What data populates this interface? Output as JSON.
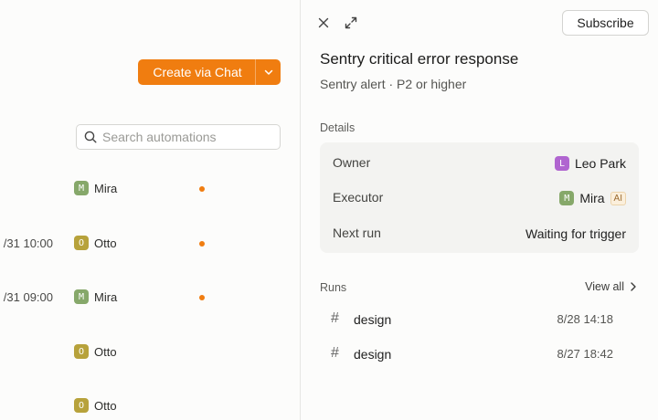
{
  "left": {
    "create_button": "Create via Chat",
    "search_placeholder": "Search automations",
    "rows": [
      {
        "time": "",
        "user_initial": "M",
        "user": "Mira",
        "dot": true
      },
      {
        "time": "/31 10:00",
        "user_initial": "O",
        "user": "Otto",
        "dot": true
      },
      {
        "time": "/31 09:00",
        "user_initial": "M",
        "user": "Mira",
        "dot": true
      },
      {
        "time": "",
        "user_initial": "O",
        "user": "Otto",
        "dot": false
      },
      {
        "time": "",
        "user_initial": "O",
        "user": "Otto",
        "dot": false
      }
    ]
  },
  "panel": {
    "subscribe": "Subscribe",
    "title": "Sentry critical error response",
    "subtitle": "Sentry alert · P2 or higher",
    "details_label": "Details",
    "details": {
      "owner_label": "Owner",
      "owner_initial": "L",
      "owner": "Leo Park",
      "executor_label": "Executor",
      "executor_initial": "M",
      "executor": "Mira",
      "executor_badge": "AI",
      "next_run_label": "Next run",
      "next_run": "Waiting for trigger"
    },
    "runs_label": "Runs",
    "view_all": "View all",
    "runs": [
      {
        "name": "design",
        "date": "8/28 14:18"
      },
      {
        "name": "design",
        "date": "8/27 18:42"
      }
    ]
  },
  "colors": {
    "accent": "#f07d10",
    "avatar_m": "#86a86a",
    "avatar_o": "#b7a23b",
    "avatar_l": "#b065d0"
  },
  "icons": [
    "close-icon",
    "expand-icon",
    "chevron-down-icon",
    "search-icon",
    "hash-icon",
    "chevron-right-icon"
  ]
}
